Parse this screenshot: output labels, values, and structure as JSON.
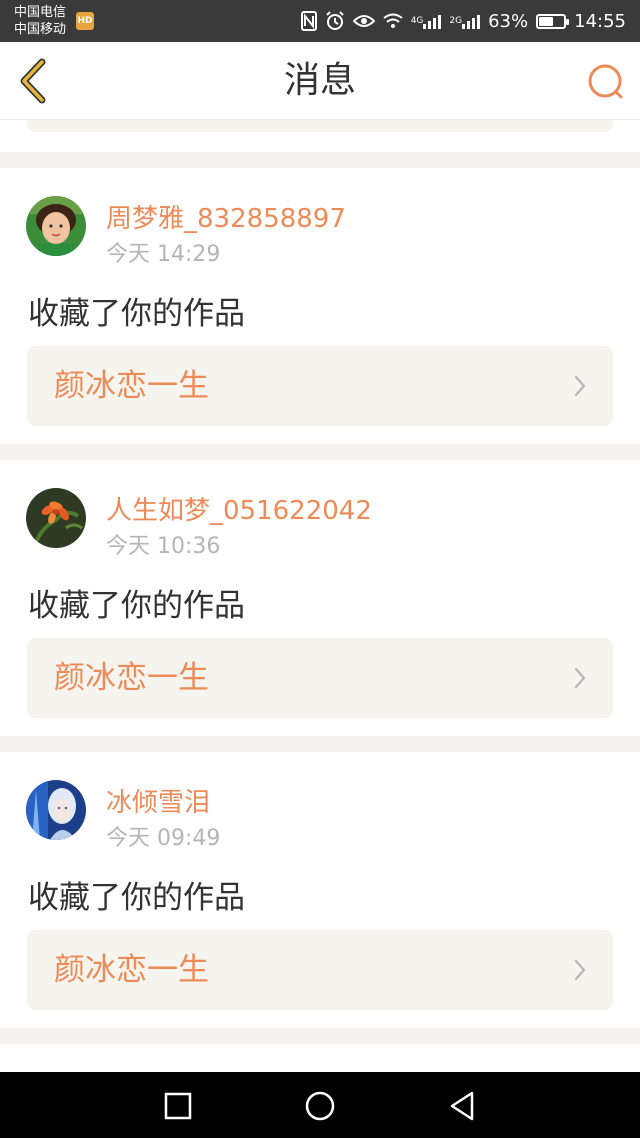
{
  "status_bar": {
    "carrier_1": "中国电信",
    "carrier_2": "中国移动",
    "net_4g": "4G",
    "net_2g": "2G",
    "battery": "63%",
    "battery_level": 0.63,
    "time": "14:55"
  },
  "header": {
    "title": "消息"
  },
  "messages": [
    {
      "username": "周梦雅_832858897",
      "time": "今天 14:29",
      "action": "收藏了你的作品",
      "work_title": "颜冰恋一生"
    },
    {
      "username": "人生如梦_051622042",
      "time": "今天 10:36",
      "action": "收藏了你的作品",
      "work_title": "颜冰恋一生"
    },
    {
      "username": "冰倾雪泪",
      "time": "今天 09:49",
      "action": "收藏了你的作品",
      "work_title": "颜冰恋一生"
    }
  ],
  "colors": {
    "accent": "#ec8b57",
    "back_icon": "#e6b53a",
    "card_box": "#f5f4ee",
    "page_bg": "#f4f3f2"
  },
  "icons": {
    "back": "chevron-left-icon",
    "search": "search-icon",
    "item_arrow": "chevron-right-icon",
    "nav_recent": "square-icon",
    "nav_home": "circle-icon",
    "nav_back": "triangle-back-icon"
  }
}
